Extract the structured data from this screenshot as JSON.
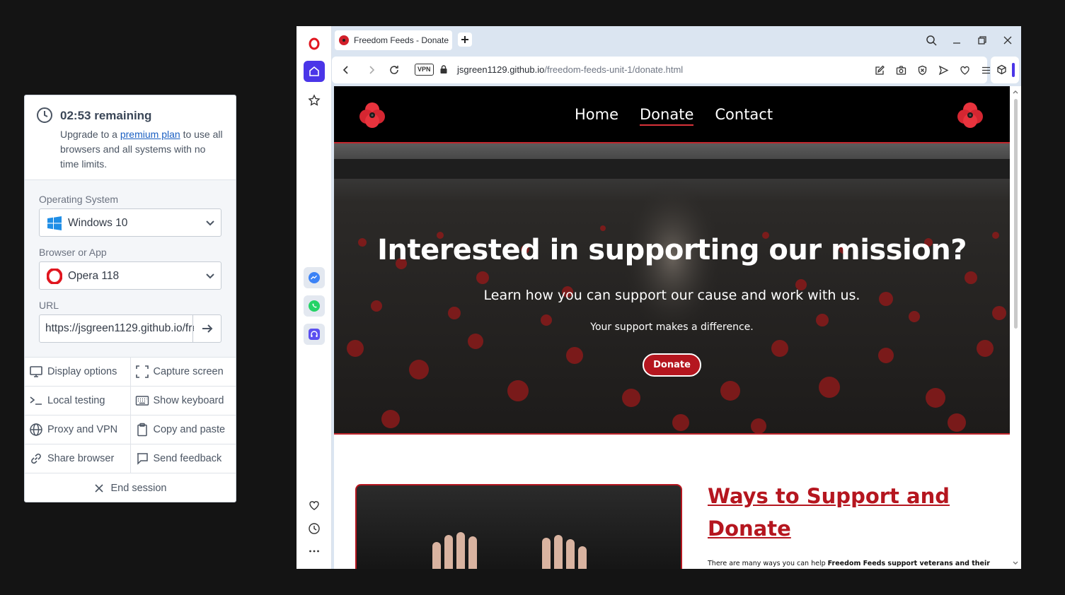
{
  "session": {
    "timer_title": "02:53 remaining",
    "upgrade_pre": "Upgrade to a",
    "upgrade_link": "premium plan",
    "upgrade_post": "to use all browsers and all systems with no time limits.",
    "os_label": "Operating System",
    "os_value": "Windows 10",
    "browser_label": "Browser or App",
    "browser_value": "Opera 118",
    "url_label": "URL",
    "url_value": "https://jsgreen1129.github.io/freedom-feeds-unit-1/donate.html",
    "actions": [
      {
        "label": "Display options",
        "icon": "monitor-icon"
      },
      {
        "label": "Capture screen",
        "icon": "capture-icon"
      },
      {
        "label": "Local testing",
        "icon": "terminal-icon"
      },
      {
        "label": "Show keyboard",
        "icon": "keyboard-icon"
      },
      {
        "label": "Proxy and VPN",
        "icon": "globe-icon"
      },
      {
        "label": "Copy and paste",
        "icon": "clipboard-icon"
      },
      {
        "label": "Share browser",
        "icon": "link-icon"
      },
      {
        "label": "Send feedback",
        "icon": "feedback-icon"
      }
    ],
    "end_session": "End session"
  },
  "browser": {
    "tab_title": "Freedom Feeds - Donate",
    "vpn_badge": "VPN",
    "url_domain": "jsgreen1129.github.io",
    "url_path": "/freedom-feeds-unit-1/donate.html",
    "accent_color": "#4a35e8"
  },
  "site": {
    "nav": {
      "home": "Home",
      "donate": "Donate",
      "contact": "Contact"
    },
    "hero": {
      "title": "Interested in supporting our mission?",
      "subtitle": "Learn how you can support our cause and work with us.",
      "tagline": "Your support makes a difference.",
      "button": "Donate"
    },
    "support": {
      "heading": "Ways to Support and Donate",
      "text_pre": "There are many ways you can help",
      "text_bold": "Freedom Feeds support veterans and their"
    },
    "brand_color": "#b5161f"
  }
}
